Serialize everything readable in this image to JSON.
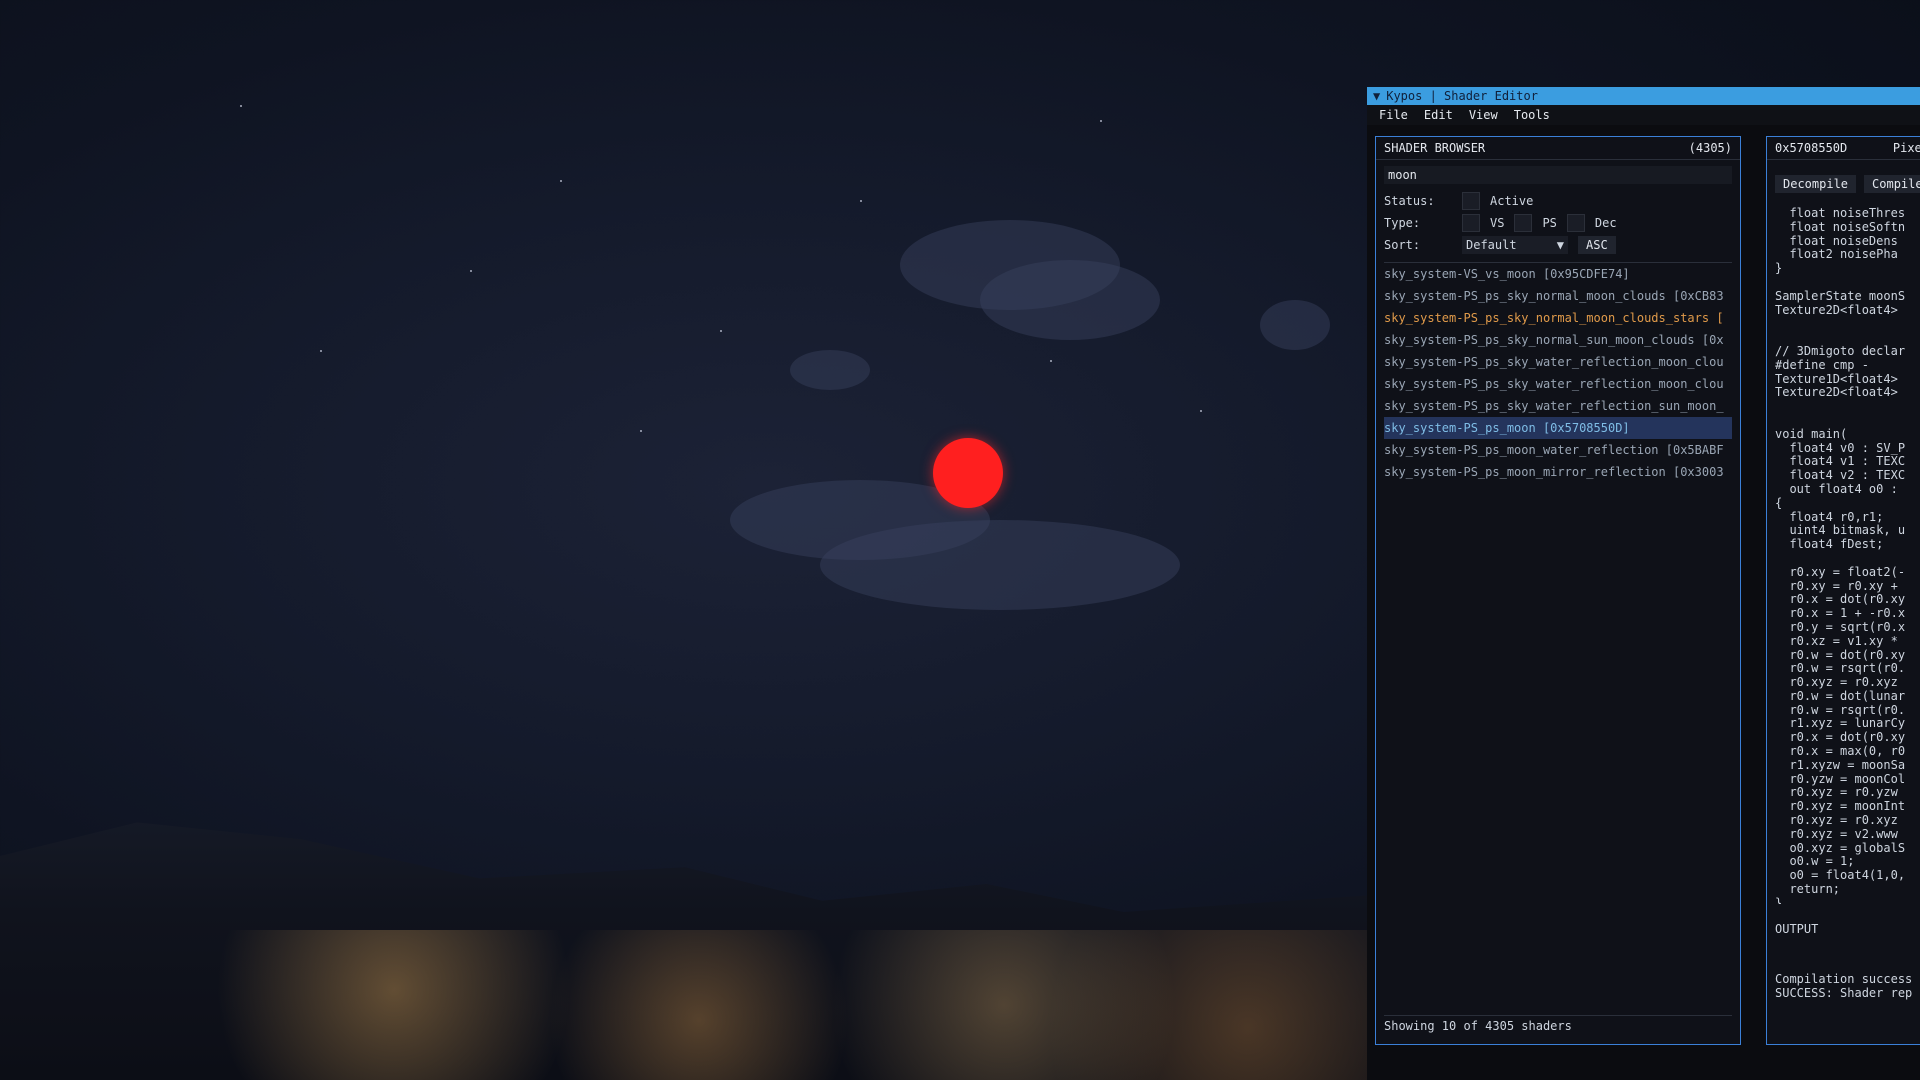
{
  "window": {
    "title": "Kypos | Shader Editor"
  },
  "menu": [
    "File",
    "Edit",
    "View",
    "Tools"
  ],
  "browser": {
    "title": "SHADER BROWSER",
    "count": "(4305)",
    "search_value": "moon",
    "status_label": "Status:",
    "status_active": "Active",
    "type_label": "Type:",
    "type_vs": "VS",
    "type_ps": "PS",
    "type_dec": "Dec",
    "sort_label": "Sort:",
    "sort_value": "Default",
    "sort_order": "ASC",
    "items": [
      "sky_system-VS_vs_moon [0x95CDFE74]",
      "sky_system-PS_ps_sky_normal_moon_clouds [0xCB83",
      "sky_system-PS_ps_sky_normal_moon_clouds_stars [",
      "sky_system-PS_ps_sky_normal_sun_moon_clouds [0x",
      "sky_system-PS_ps_sky_water_reflection_moon_clou",
      "sky_system-PS_ps_sky_water_reflection_moon_clou",
      "sky_system-PS_ps_sky_water_reflection_sun_moon_",
      "sky_system-PS_ps_moon [0x5708550D]",
      "sky_system-PS_ps_moon_water_reflection [0x5BABF",
      "sky_system-PS_ps_moon_mirror_reflection [0x3003"
    ],
    "footer": "Showing 10 of 4305 shaders"
  },
  "editor": {
    "hash": "0x5708550D",
    "kind": "Pixel",
    "decompile_label": "Decompile",
    "compile_label": "Compile",
    "code": "  float noiseThres\n  float noiseSoftn\n  float noiseDens\n  float2 noisePha\n}\n\nSamplerState moonS\nTexture2D<float4>\n\n\n// 3Dmigoto declar\n#define cmp -\nTexture1D<float4>\nTexture2D<float4>\n\n\nvoid main(\n  float4 v0 : SV_P\n  float4 v1 : TEXC\n  float4 v2 : TEXC\n  out float4 o0 :\n{\n  float4 r0,r1;\n  uint4 bitmask, u\n  float4 fDest;\n\n  r0.xy = float2(-\n  r0.xy = r0.xy +\n  r0.x = dot(r0.xy\n  r0.x = 1 + -r0.x\n  r0.y = sqrt(r0.x\n  r0.xz = v1.xy *\n  r0.w = dot(r0.xy\n  r0.w = rsqrt(r0.\n  r0.xyz = r0.xyz\n  r0.w = dot(lunar\n  r0.w = rsqrt(r0.\n  r1.xyz = lunarCy\n  r0.x = dot(r0.xy\n  r0.x = max(0, r0\n  r1.xyzw = moonSa\n  r0.yzw = moonCol\n  r0.xyz = r0.yzw\n  r0.xyz = moonInt\n  r0.xyz = r0.xyz\n  r0.xyz = v2.www\n  o0.xyz = globalS\n  o0.w = 1;\n  o0 = float4(1,0,\n  return;\n}",
    "output_title": "OUTPUT",
    "output_text": "Compilation success\nSUCCESS: Shader rep"
  }
}
